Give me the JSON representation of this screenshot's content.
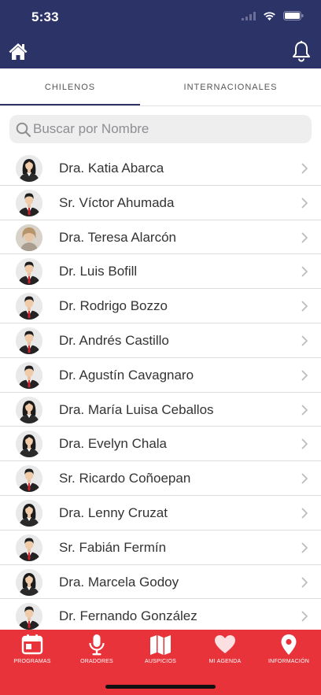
{
  "status_bar": {
    "time": "5:33"
  },
  "header": {
    "home_icon": "home-icon",
    "bell_icon": "bell-icon"
  },
  "tabs": [
    {
      "label": "CHILENOS",
      "selected": true
    },
    {
      "label": "INTERNACIONALES",
      "selected": false
    }
  ],
  "search": {
    "placeholder": "Buscar por Nombre",
    "value": ""
  },
  "people": [
    {
      "name": "Dra. Katia Abarca",
      "avatar": "female"
    },
    {
      "name": "Sr. Víctor Ahumada",
      "avatar": "male"
    },
    {
      "name": "Dra. Teresa Alarcón",
      "avatar": "photo"
    },
    {
      "name": "Dr. Luis Bofill",
      "avatar": "male"
    },
    {
      "name": "Dr. Rodrigo Bozzo",
      "avatar": "male"
    },
    {
      "name": "Dr. Andrés Castillo",
      "avatar": "male"
    },
    {
      "name": "Dr. Agustín Cavagnaro",
      "avatar": "male"
    },
    {
      "name": "Dra. María Luisa Ceballos",
      "avatar": "female"
    },
    {
      "name": "Dra. Evelyn Chala",
      "avatar": "female"
    },
    {
      "name": "Sr. Ricardo Coñoepan",
      "avatar": "male"
    },
    {
      "name": "Dra. Lenny Cruzat",
      "avatar": "female"
    },
    {
      "name": "Sr. Fabián Fermín",
      "avatar": "male"
    },
    {
      "name": "Dra. Marcela Godoy",
      "avatar": "female"
    },
    {
      "name": "Dr. Fernando González",
      "avatar": "male"
    }
  ],
  "tabbar": [
    {
      "label": "PROGRAMAS",
      "icon": "calendar-icon"
    },
    {
      "label": "ORADORES",
      "icon": "microphone-icon"
    },
    {
      "label": "AUSPICIOS",
      "icon": "map-icon"
    },
    {
      "label": "MI AGENDA",
      "icon": "heart-icon"
    },
    {
      "label": "INFORMACIÓN",
      "icon": "location-pin-icon"
    }
  ],
  "colors": {
    "header": "#2c3367",
    "tabbar": "#e8333a",
    "tie": "#cc1f2b"
  }
}
